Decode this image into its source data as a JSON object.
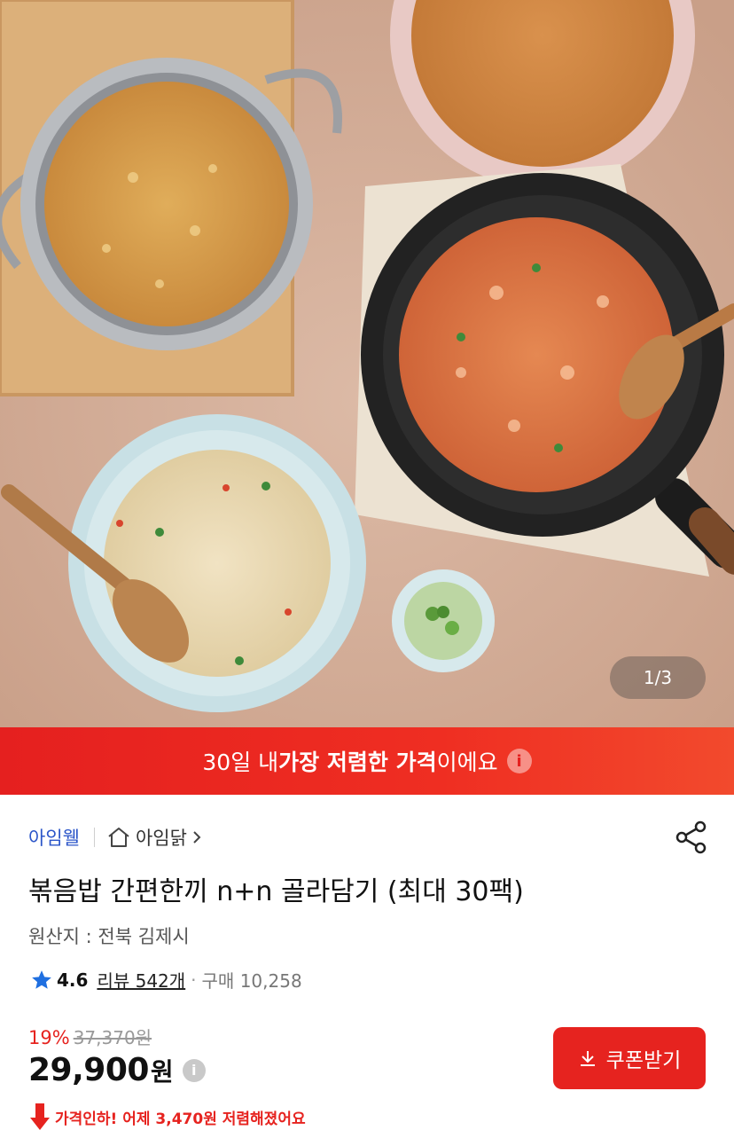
{
  "gallery": {
    "pager": "1/3"
  },
  "banner": {
    "prefix": "30일 내 ",
    "highlight": "가장 저렴한 가격",
    "suffix": "이에요",
    "info_icon": "info-icon"
  },
  "product": {
    "brand": "아임웰",
    "store": "아임닭",
    "title": "볶음밥 간편한끼 n+n 골라담기 (최대 30팩)",
    "origin": "원산지 : 전북 김제시",
    "rating": "4.6",
    "reviews": "리뷰 542개",
    "purchase": "구매 10,258",
    "discount_rate": "19%",
    "original_price": "37,370원",
    "price": "29,900",
    "price_unit": "원",
    "price_drop": "가격인하! 어제 3,470원 저렴해졌어요"
  },
  "actions": {
    "coupon": "쿠폰받기"
  },
  "colors": {
    "accent": "#e6231f",
    "brand": "#2c56c9",
    "star": "#1f6fe0"
  }
}
